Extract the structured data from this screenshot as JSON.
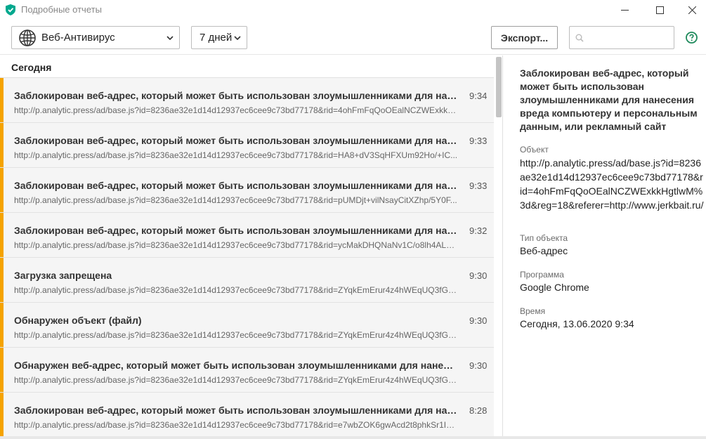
{
  "window": {
    "title": "Подробные отчеты"
  },
  "toolbar": {
    "component_select": {
      "value": "Веб-Антивирус",
      "icon": "globe-icon"
    },
    "period_select": {
      "value": "7 дней"
    },
    "export_label": "Экспорт...",
    "search": {
      "placeholder": "",
      "value": ""
    }
  },
  "list": {
    "group_header": "Сегодня",
    "accent_color": "#f5a300",
    "items": [
      {
        "title": "Заблокирован веб-адрес, который может быть использован злоумышленниками для нанесения вреда компьютеру",
        "time": "9:34",
        "url": "http://p.analytic.press/ad/base.js?id=8236ae32e1d14d12937ec6cee9c73bd77178&rid=4ohFmFqQoOEalNCZWExkkHg..."
      },
      {
        "title": "Заблокирован веб-адрес, который может быть использован злоумышленниками для нанесения вреда компьютеру",
        "time": "9:33",
        "url": "http://p.analytic.press/ad/base.js?id=8236ae32e1d14d12937ec6cee9c73bd77178&rid=HA8+dV3SqHFXUm92Ho/+IC..."
      },
      {
        "title": "Заблокирован веб-адрес, который может быть использован злоумышленниками для нанесения вреда компьютеру",
        "time": "9:33",
        "url": "http://p.analytic.press/ad/base.js?id=8236ae32e1d14d12937ec6cee9c73bd77178&rid=pUMDjt+vilNsayCitXZhp/5Y0F..."
      },
      {
        "title": "Заблокирован веб-адрес, который может быть использован злоумышленниками для нанесения вреда компьютеру",
        "time": "9:32",
        "url": "http://p.analytic.press/ad/base.js?id=8236ae32e1d14d12937ec6cee9c73bd77178&rid=ycMakDHQNaNv1C/o8lh4ALsY..."
      },
      {
        "title": "Загрузка запрещена",
        "time": "9:30",
        "url": "http://p.analytic.press/ad/base.js?id=8236ae32e1d14d12937ec6cee9c73bd77178&rid=ZYqkEmErur4z4hWEqUQ3fGJU..."
      },
      {
        "title": "Обнаружен объект (файл)",
        "time": "9:30",
        "url": "http://p.analytic.press/ad/base.js?id=8236ae32e1d14d12937ec6cee9c73bd77178&rid=ZYqkEmErur4z4hWEqUQ3fGJU..."
      },
      {
        "title": "Обнаружен веб-адрес, который может быть использован злоумышленниками для нанесения вреда компьютеру",
        "time": "9:30",
        "url": "http://p.analytic.press/ad/base.js?id=8236ae32e1d14d12937ec6cee9c73bd77178&rid=ZYqkEmErur4z4hWEqUQ3fGJU..."
      },
      {
        "title": "Заблокирован веб-адрес, который может быть использован злоумышленниками для нанесения вреда компьютеру",
        "time": "8:28",
        "url": "http://p.analytic.press/ad/base.js?id=8236ae32e1d14d12937ec6cee9c73bd77178&rid=e7wbZOK6gwAcd2t8phkSr1I7g..."
      }
    ]
  },
  "details": {
    "title": "Заблокирован веб-адрес, который может быть использован злоумышленниками для нанесения вреда компьютеру и персональным данным, или рекламный сайт",
    "object_label": "Объект",
    "object_value": "http://p.analytic.press/ad/base.js?id=8236ae32e1d14d12937ec6cee9c73bd77178&rid=4ohFmFqQoOEalNCZWExkkHgtlwM%3d&reg=18&referer=http://www.jerkbait.ru/",
    "type_label": "Тип объекта",
    "type_value": "Веб-адрес",
    "program_label": "Программа",
    "program_value": "Google Chrome",
    "time_label": "Время",
    "time_value": "Сегодня, 13.06.2020 9:34"
  }
}
